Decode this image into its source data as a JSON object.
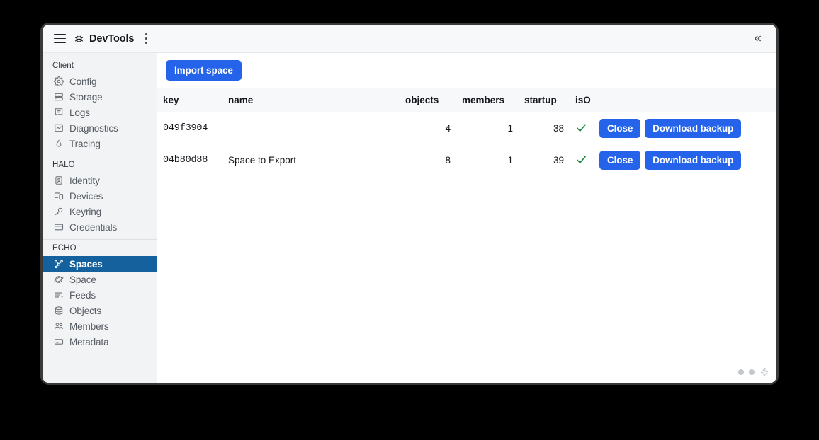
{
  "titlebar": {
    "menu_icon": "hamburger-icon",
    "logo_icon": "bug-icon",
    "title": "DevTools",
    "overflow_icon": "kebab-menu-icon",
    "collapse_label": "«"
  },
  "sidebar": {
    "sections": [
      {
        "label": "Client",
        "items": [
          {
            "label": "Config",
            "icon": "gear-icon",
            "selected": false
          },
          {
            "label": "Storage",
            "icon": "database-stack-icon",
            "selected": false
          },
          {
            "label": "Logs",
            "icon": "receipt-icon",
            "selected": false
          },
          {
            "label": "Diagnostics",
            "icon": "line-chart-icon",
            "selected": false
          },
          {
            "label": "Tracing",
            "icon": "flame-icon",
            "selected": false
          }
        ]
      },
      {
        "label": "HALO",
        "items": [
          {
            "label": "Identity",
            "icon": "identity-card-icon",
            "selected": false
          },
          {
            "label": "Devices",
            "icon": "devices-icon",
            "selected": false
          },
          {
            "label": "Keyring",
            "icon": "key-icon",
            "selected": false
          },
          {
            "label": "Credentials",
            "icon": "credit-card-icon",
            "selected": false
          }
        ]
      },
      {
        "label": "ECHO",
        "items": [
          {
            "label": "Spaces",
            "icon": "graph-network-icon",
            "selected": true
          },
          {
            "label": "Space",
            "icon": "planet-icon",
            "selected": false
          },
          {
            "label": "Feeds",
            "icon": "feed-list-icon",
            "selected": false
          },
          {
            "label": "Objects",
            "icon": "database-icon",
            "selected": false
          },
          {
            "label": "Members",
            "icon": "users-icon",
            "selected": false
          },
          {
            "label": "Metadata",
            "icon": "metadata-card-icon",
            "selected": false
          }
        ]
      }
    ]
  },
  "main": {
    "toolbar": {
      "import_label": "Import space"
    },
    "table": {
      "columns": [
        {
          "key": "key",
          "label": "key",
          "align": "left"
        },
        {
          "key": "name",
          "label": "name",
          "align": "left"
        },
        {
          "key": "objects",
          "label": "objects",
          "align": "right"
        },
        {
          "key": "members",
          "label": "members",
          "align": "right"
        },
        {
          "key": "startup",
          "label": "startup",
          "align": "right"
        },
        {
          "key": "isopen",
          "label": "isO",
          "align": "left"
        }
      ],
      "rows": [
        {
          "key": "049f3904",
          "name": "",
          "objects": "4",
          "members": "1",
          "startup": "38",
          "isopen": true,
          "isopen_glyph": "✓",
          "close_label": "Close",
          "download_label": "Download backup"
        },
        {
          "key": "04b80d88",
          "name": "Space to Export",
          "objects": "8",
          "members": "1",
          "startup": "39",
          "isopen": true,
          "isopen_glyph": "✓",
          "close_label": "Close",
          "download_label": "Download backup"
        }
      ]
    },
    "statusbar": {
      "dot1": "status-dot",
      "dot2": "status-dot",
      "bolt": "lightning-bolt-icon"
    }
  },
  "colors": {
    "accent_blue": "#2563eb",
    "selected_nav": "#15619d",
    "check_green": "#15803d",
    "sidebar_bg": "#f1f3f5",
    "header_bg": "#f7f8fa",
    "window_border": "#3a3a3a"
  }
}
